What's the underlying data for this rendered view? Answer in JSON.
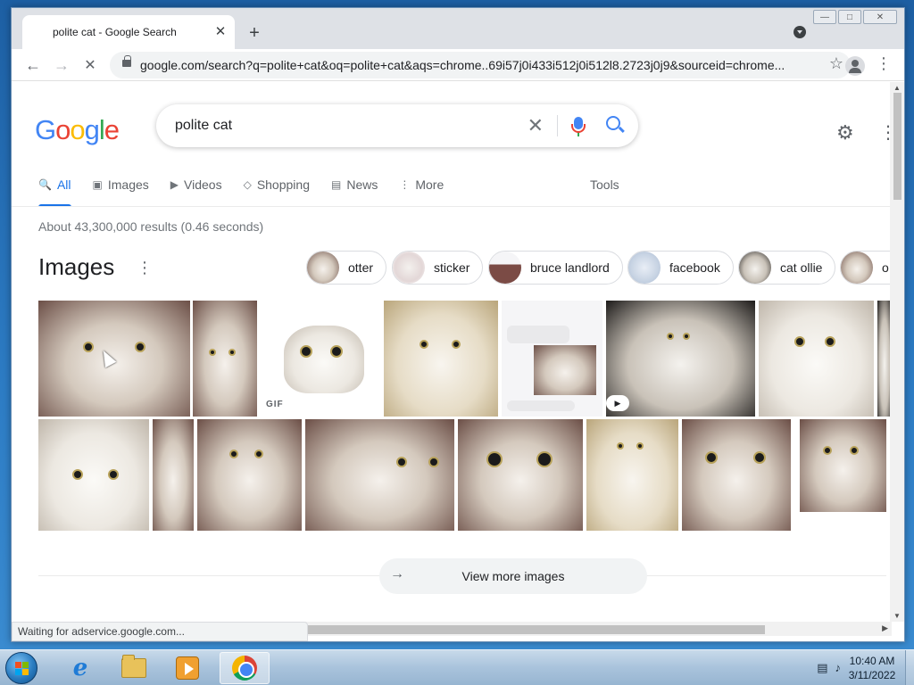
{
  "browser": {
    "tab_title": "polite cat - Google Search",
    "new_tab": "+",
    "tab_close": "✕",
    "url": "google.com/search?q=polite+cat&oq=polite+cat&aqs=chrome..69i57j0i433i512j0i512l8.2723j0j9&sourceid=chrome...",
    "status_text": "Waiting for adservice.google.com..."
  },
  "search": {
    "query": "polite cat",
    "clear": "✕"
  },
  "nav": {
    "items": [
      {
        "label": "All",
        "icon": "search-icon",
        "active": true
      },
      {
        "label": "Images",
        "icon": "image-icon",
        "active": false
      },
      {
        "label": "Videos",
        "icon": "play-icon",
        "active": false
      },
      {
        "label": "Shopping",
        "icon": "tag-icon",
        "active": false
      },
      {
        "label": "News",
        "icon": "newspaper-icon",
        "active": false
      },
      {
        "label": "More",
        "icon": "more-icon",
        "active": false
      }
    ],
    "tools": "Tools"
  },
  "results": {
    "stats": "About 43,300,000 results (0.46 seconds)"
  },
  "images": {
    "title": "Images",
    "chips": [
      "otter",
      "sticker",
      "bruce landlord",
      "facebook",
      "cat ollie",
      "o"
    ],
    "gif_badge": "GIF",
    "view_more": "View more images"
  },
  "taskbar": {
    "time": "10:40 AM",
    "date": "3/11/2022",
    "apps": [
      "internet-explorer",
      "file-explorer",
      "media-player",
      "chrome"
    ]
  },
  "colors": {
    "accent": "#1a73e8",
    "google_blue": "#4285f4",
    "google_red": "#ea4335",
    "google_yellow": "#fbbc05",
    "google_green": "#34a853"
  }
}
